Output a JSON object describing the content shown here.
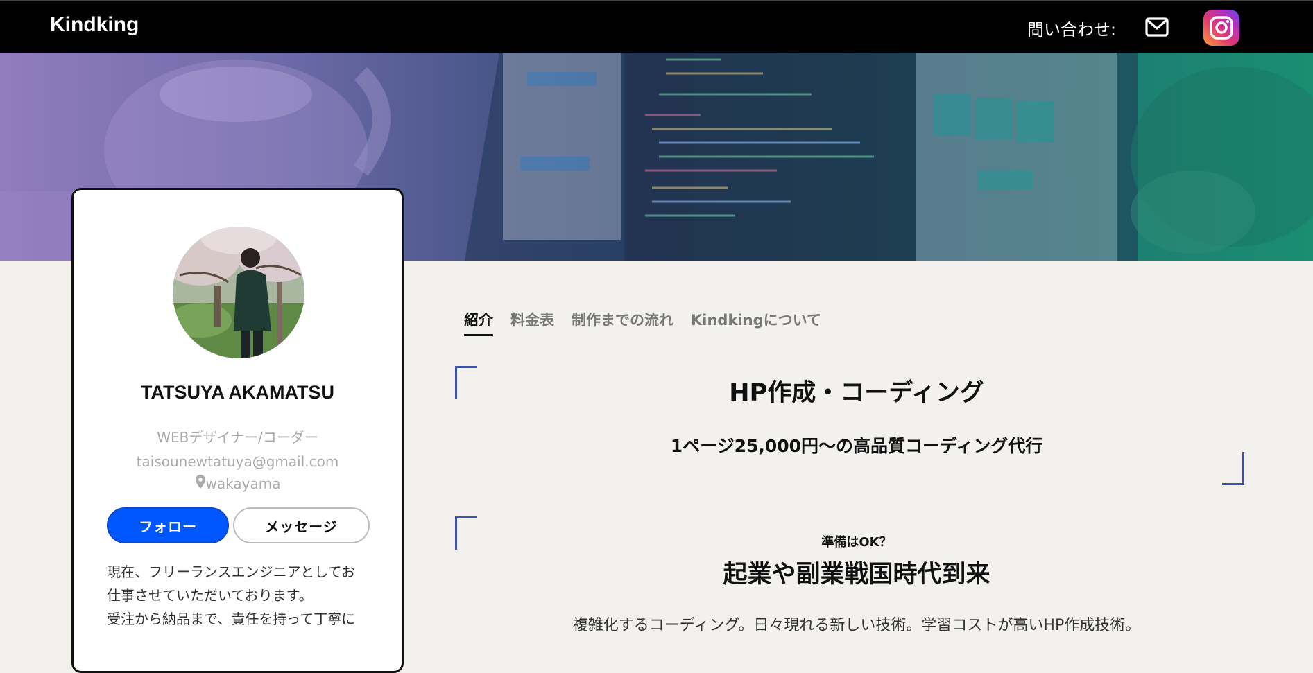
{
  "navbar": {
    "brand": "Kindking",
    "contact_label": "問い合わせ:",
    "mail_icon": "envelope-icon",
    "instagram_icon": "instagram-icon"
  },
  "profile": {
    "name": "TATSUYA AKAMATSU",
    "role": "WEBデザイナー/コーダー",
    "email": "taisounewtatuya@gmail.com",
    "location": "wakayama",
    "location_icon": "map-pin-icon",
    "follow_label": "フォロー",
    "message_label": "メッセージ",
    "bio_lines": [
      "現在、フリーランスエンジニアとしてお",
      "仕事させていただいております。",
      "受注から納品まで、責任を持って丁寧に"
    ]
  },
  "tabs": [
    {
      "label": "紹介",
      "active": true
    },
    {
      "label": "料金表",
      "active": false
    },
    {
      "label": "制作までの流れ",
      "active": false
    },
    {
      "label": "Kindkingについて",
      "active": false
    }
  ],
  "section1": {
    "title": "HP作成・コーディング",
    "subtitle": "1ページ25,000円〜の高品質コーディング代行"
  },
  "section2": {
    "kicker": "準備はOK？",
    "title": "起業や副業戦国時代到来",
    "text": "複雑化するコーディング。日々現れる新しい技術。学習コストが高いHP作成技術。"
  },
  "colors": {
    "accent_blue": "#0057ff",
    "bracket_blue": "#3d4fa8",
    "navbar_bg": "#000000",
    "page_bg": "#f3f1ee"
  }
}
